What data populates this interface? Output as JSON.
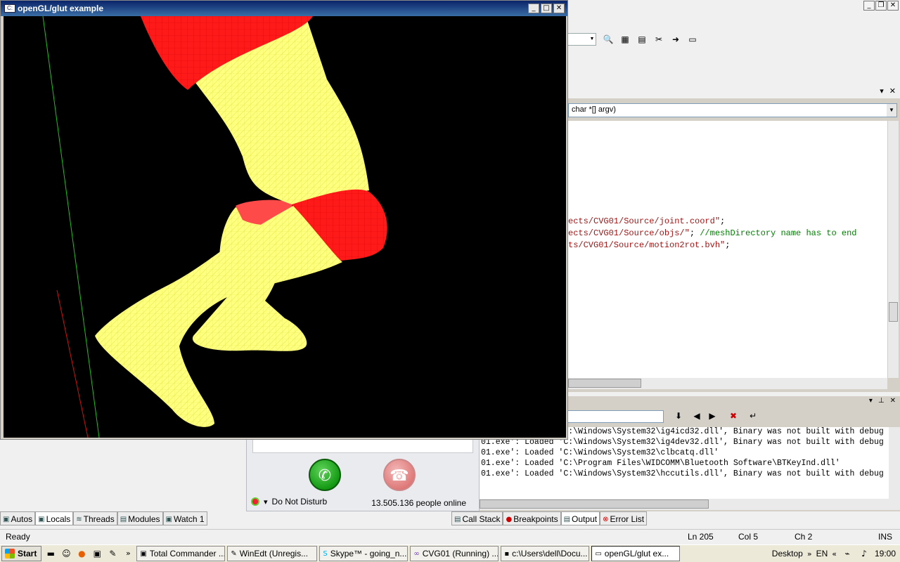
{
  "ide": {
    "member_combo": "char *[] argv)",
    "code_lines": [
      {
        "str": "ects/CVG01/Source/joint.coord\"",
        "rest": ";"
      },
      {
        "str": "ects/CVG01/Source/objs/\"",
        "rest": "; ",
        "comment": "//meshDirectory name has to end"
      },
      {
        "str": "ts/CVG01/Source/motion2rot.bvh\"",
        "rest": ";"
      }
    ]
  },
  "output": {
    "lines": [
      "01.exe': Loaded 'C:\\Windows\\System32\\ig4icd32.dll', Binary was not built with debug",
      "01.exe': Loaded 'C:\\Windows\\System32\\ig4dev32.dll', Binary was not built with debug",
      "01.exe': Loaded 'C:\\Windows\\System32\\clbcatq.dll'",
      "01.exe': Loaded 'C:\\Program Files\\WIDCOMM\\Bluetooth Software\\BTKeyInd.dll'",
      "01.exe': Loaded 'C:\\Windows\\System32\\hccutils.dll', Binary was not built with debug"
    ]
  },
  "debug_tabs_left": [
    "Autos",
    "Locals",
    "Threads",
    "Modules",
    "Watch 1"
  ],
  "debug_tabs_right": [
    "Call Stack",
    "Breakpoints",
    "Output",
    "Error List"
  ],
  "status": {
    "ready": "Ready",
    "ln": "Ln 205",
    "col": "Col 5",
    "ch": "Ch 2",
    "ins": "INS"
  },
  "skype": {
    "status": "Do Not Disturb",
    "online": "13.505.136 people online"
  },
  "gl_window": {
    "title": "openGL/glut example"
  },
  "taskbar": {
    "start": "Start",
    "tasks": [
      "Total Commander ...",
      "WinEdt (Unregis...",
      "Skype™ - going_n...",
      "CVG01 (Running) ...",
      "c:\\Users\\dell\\Docu...",
      "openGL/glut ex..."
    ],
    "desktop": "Desktop",
    "lang": "EN",
    "clock": "19:00"
  },
  "colors": {
    "mesh_yellow": "#ffff7a",
    "mesh_red": "#ff1a1a",
    "title_blue": "#0a246a"
  }
}
